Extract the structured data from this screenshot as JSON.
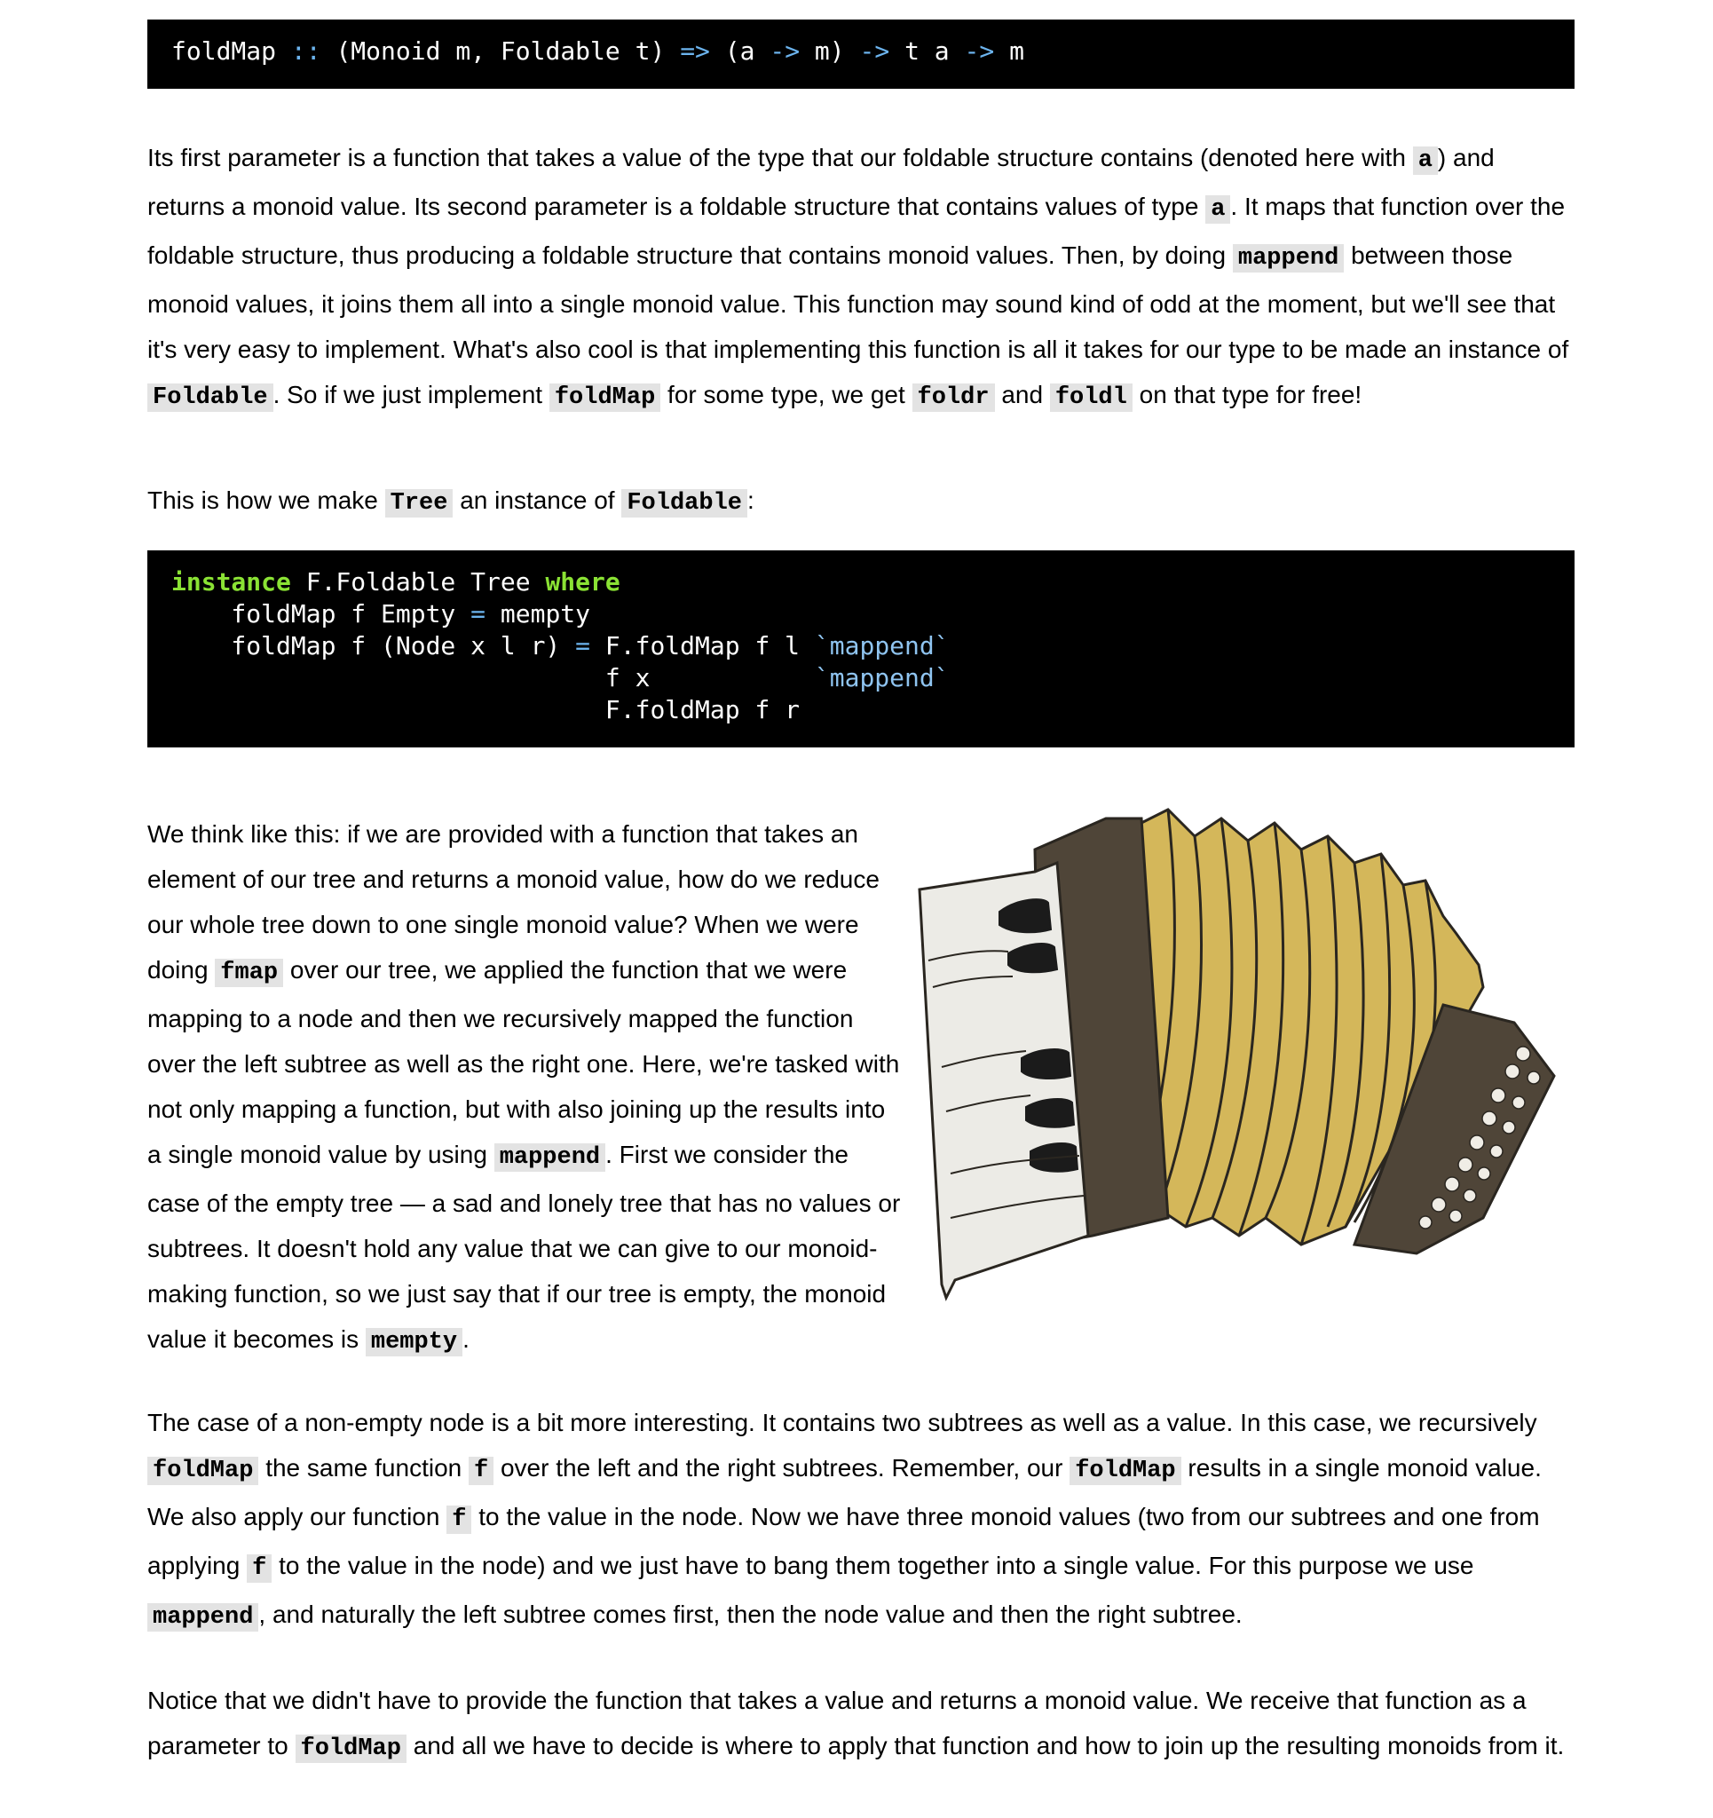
{
  "code1": {
    "fn": "foldMap",
    "sep": "::",
    "ctx": "(Monoid m, Foldable t)",
    "arrow_ctx": "=>",
    "arg1": "(a",
    "arr1": "->",
    "arg1b": "m)",
    "arr2": "->",
    "arg2": "t a",
    "arr3": "->",
    "ret": "m"
  },
  "p1": {
    "t1": "Its first parameter is a function that takes a value of the type that our foldable structure contains (denoted here with ",
    "c1": "a",
    "t2": ") and returns a monoid value. Its second parameter is a foldable structure that contains values of type ",
    "c2": "a",
    "t3": ". It maps that function over the foldable structure, thus producing a foldable structure that contains monoid values. Then, by doing ",
    "c3": "mappend",
    "t4": " between those monoid values, it joins them all into a single monoid value. This function may sound kind of odd at the moment, but we'll see that it's very easy to implement. What's also cool is that implementing this function is all it takes for our type to be made an instance of ",
    "c4": "Foldable",
    "t5": ". So if we just implement ",
    "c5": "foldMap",
    "t6": " for some type, we get ",
    "c6": "foldr",
    "t7": " and ",
    "c7": "foldl",
    "t8": " on that type for free!"
  },
  "p2": {
    "t1": "This is how we make ",
    "c1": "Tree",
    "t2": " an instance of ",
    "c2": "Foldable",
    "t3": ":"
  },
  "code2": {
    "kw_instance": "instance",
    "l1_mid": " F.Foldable Tree ",
    "kw_where": "where",
    "l2a": "    foldMap f Empty ",
    "eq1": "=",
    "l2b": " mempty",
    "l3a": "    foldMap f (Node x l r) ",
    "eq2": "=",
    "l3b": " F.foldMap f l ",
    "bt1": "`mappend`",
    "l4a": "                             f x           ",
    "bt2": "`mappend`",
    "l5": "                             F.foldMap f r"
  },
  "p3": {
    "t1": "We think like this: if we are provided with a function that takes an element of our tree and returns a monoid value, how do we reduce our whole tree down to one single monoid value? When we were doing ",
    "c1": "fmap",
    "t2": " over our tree, we applied the function that we were mapping to a node and then we recursively mapped the function over the left subtree as well as the right one. Here, we're tasked with not only mapping a function, but with also joining up the results into a single monoid value by using ",
    "c2": "mappend",
    "t3": ". First we consider the case of the empty tree — a sad and lonely tree that has no values or subtrees. It doesn't hold any value that we can give to our monoid-making function, so we just say that if our tree is empty, the monoid value it becomes is ",
    "c3": "mempty",
    "t4": "."
  },
  "p4": {
    "t1": "The case of a non-empty node is a bit more interesting. It contains two subtrees as well as a value. In this case, we recursively ",
    "c1": "foldMap",
    "t2": " the same function ",
    "c2": "f",
    "t3": " over the left and the right subtrees. Remember, our ",
    "c3": "foldMap",
    "t4": " results in a single monoid value. We also apply our function ",
    "c4": "f",
    "t5": " to the value in the node. Now we have three monoid values (two from our subtrees and one from applying ",
    "c5": "f",
    "t6": " to the value in the node) and we just have to bang them together into a single value. For this purpose we use ",
    "c6": "mappend",
    "t7": ", and naturally the left subtree comes first, then the node value and then the right subtree."
  },
  "p5": {
    "t1": "Notice that we didn't have to provide the function that takes a value and returns a monoid value. We receive that function as a parameter to ",
    "c1": "foldMap",
    "t2": " and all we have to decide is where to apply that function and how to join up the resulting monoids from it."
  },
  "colors": {
    "code_bg": "#000000",
    "inline_code_bg": "#e3e3e3",
    "keyword": "#8ae234",
    "operator": "#6cb4ee",
    "bellows": "#d4b75a",
    "frame": "#4f4538"
  },
  "illustration": {
    "icon": "accordion-icon"
  }
}
